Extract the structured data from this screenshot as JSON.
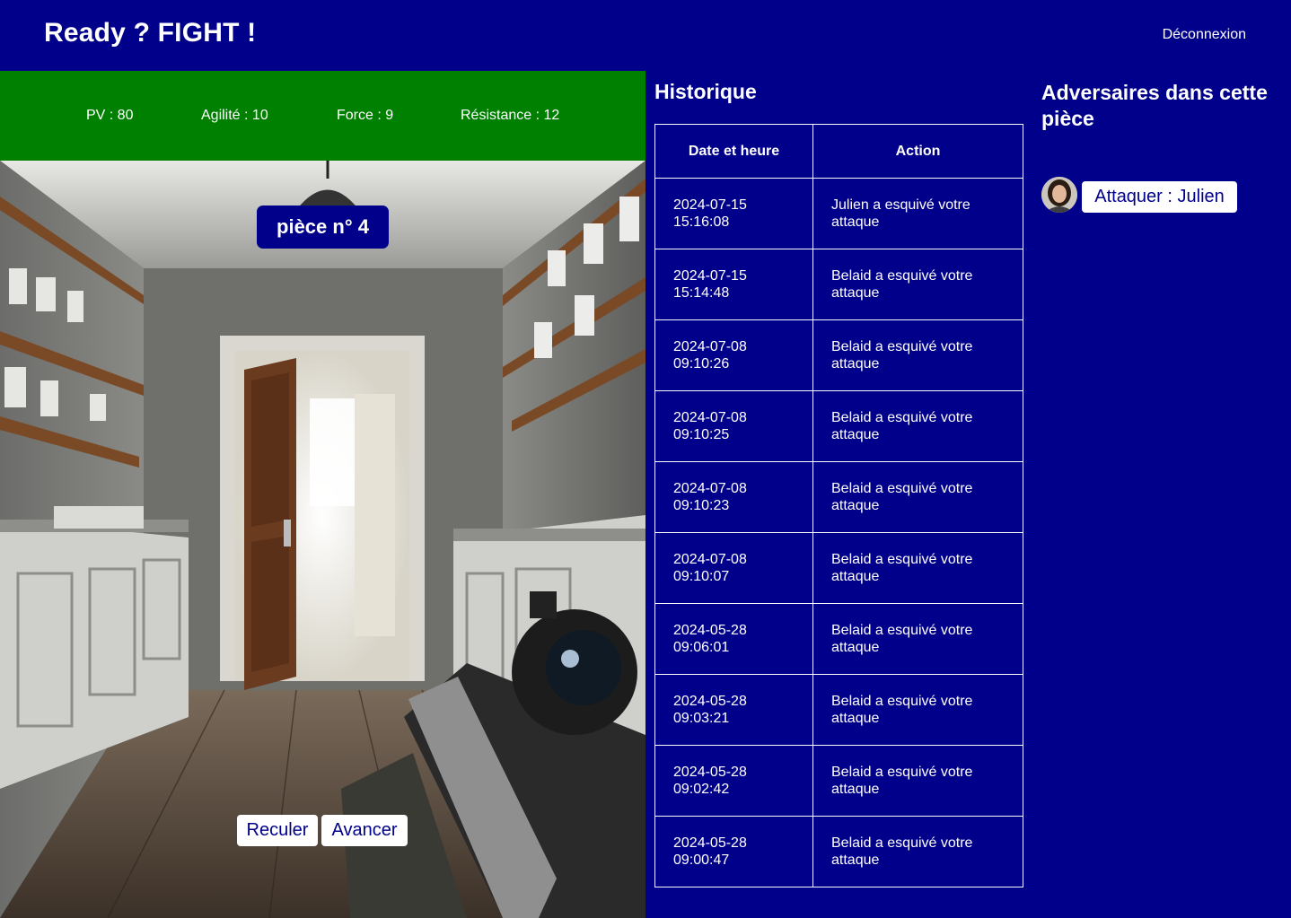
{
  "header": {
    "title": "Ready ? FIGHT !",
    "logout_label": "Déconnexion"
  },
  "stats": {
    "pv": "PV : 80",
    "agility": "Agilité : 10",
    "force": "Force : 9",
    "resistance": "Résistance : 12"
  },
  "scene": {
    "room_label": "pièce n° 4",
    "back_label": "Reculer",
    "forward_label": "Avancer"
  },
  "history": {
    "title": "Historique",
    "columns": [
      "Date et heure",
      "Action"
    ],
    "rows": [
      {
        "date": "2024-07-15",
        "time": "15:16:08",
        "action": "Julien a esquivé votre attaque"
      },
      {
        "date": "2024-07-15",
        "time": "15:14:48",
        "action": "Belaid a esquivé votre attaque"
      },
      {
        "date": "2024-07-08",
        "time": "09:10:26",
        "action": "Belaid a esquivé votre attaque"
      },
      {
        "date": "2024-07-08",
        "time": "09:10:25",
        "action": "Belaid a esquivé votre attaque"
      },
      {
        "date": "2024-07-08",
        "time": "09:10:23",
        "action": "Belaid a esquivé votre attaque"
      },
      {
        "date": "2024-07-08",
        "time": "09:10:07",
        "action": "Belaid a esquivé votre attaque"
      },
      {
        "date": "2024-05-28",
        "time": "09:06:01",
        "action": "Belaid a esquivé votre attaque"
      },
      {
        "date": "2024-05-28",
        "time": "09:03:21",
        "action": "Belaid a esquivé votre attaque"
      },
      {
        "date": "2024-05-28",
        "time": "09:02:42",
        "action": "Belaid a esquivé votre attaque"
      },
      {
        "date": "2024-05-28",
        "time": "09:00:47",
        "action": "Belaid a esquivé votre attaque"
      }
    ]
  },
  "adversaries": {
    "title": "Adversaires dans cette pièce",
    "items": [
      {
        "attack_label": "Attaquer : Julien"
      }
    ]
  },
  "colors": {
    "background": "#00008b",
    "stats_bar": "#008000",
    "button_bg": "#ffffff",
    "button_text": "#00008b"
  }
}
